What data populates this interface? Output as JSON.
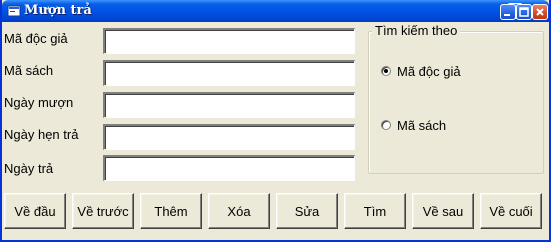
{
  "window": {
    "title": "Mượn trả"
  },
  "form": {
    "fields": [
      {
        "label": "Mã độc giả",
        "value": ""
      },
      {
        "label": "Mã sách",
        "value": ""
      },
      {
        "label": "Ngày mượn",
        "value": ""
      },
      {
        "label": "Ngày hẹn trả",
        "value": ""
      },
      {
        "label": "Ngày trả",
        "value": ""
      }
    ]
  },
  "search_group": {
    "legend": "Tìm kiếm theo",
    "options": [
      {
        "label": "Mã độc giả",
        "selected": true
      },
      {
        "label": "Mã sách",
        "selected": false
      }
    ]
  },
  "buttons": {
    "first": "Về đầu",
    "prev": "Về trước",
    "add": "Thêm",
    "delete": "Xóa",
    "edit": "Sửa",
    "find": "Tìm",
    "next": "Về sau",
    "last": "Về cuối"
  }
}
